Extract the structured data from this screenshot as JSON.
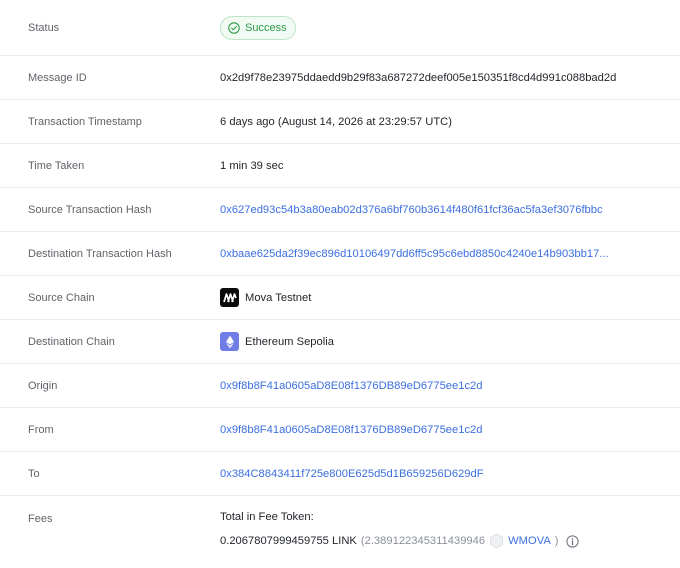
{
  "rows": {
    "status": {
      "label": "Status",
      "value": "Success"
    },
    "message_id": {
      "label": "Message ID",
      "value": "0x2d9f78e23975ddaedd9b29f83a687272deef005e150351f8cd4d991c088bad2d"
    },
    "timestamp": {
      "label": "Transaction Timestamp",
      "value": "6 days ago (August 14, 2026 at 23:29:57 UTC)"
    },
    "time_taken": {
      "label": "Time Taken",
      "value": "1 min 39 sec"
    },
    "source_tx": {
      "label": "Source Transaction Hash",
      "value": "0x627ed93c54b3a80eab02d376a6bf760b3614f480f61fcf36ac5fa3ef3076fbbc"
    },
    "dest_tx": {
      "label": "Destination Transaction Hash",
      "value": "0xbaae625da2f39ec896d10106497dd6ff5c95c6ebd8850c4240e14b903bb17..."
    },
    "source_chain": {
      "label": "Source Chain",
      "value": "Mova Testnet",
      "icon": "mova-logo-icon"
    },
    "dest_chain": {
      "label": "Destination Chain",
      "value": "Ethereum Sepolia",
      "icon": "ethereum-logo-icon"
    },
    "origin": {
      "label": "Origin",
      "value": "0x9f8b8F41a0605aD8E08f1376DB89eD6775ee1c2d"
    },
    "from": {
      "label": "From",
      "value": "0x9f8b8F41a0605aD8E08f1376DB89eD6775ee1c2d"
    },
    "to": {
      "label": "To",
      "value": "0x384C8843411f725e800E625d5d1B659256D629dF"
    },
    "fees": {
      "label": "Fees",
      "title": "Total in Fee Token:",
      "amount": "0.2067807999459755 LINK",
      "paren_open": "(2.389122345311439946",
      "token": "WMOVA",
      "paren_close": ")"
    }
  },
  "colors": {
    "link": "#3b6fe0",
    "success": "#2e9a4a",
    "label": "#5f6368"
  }
}
